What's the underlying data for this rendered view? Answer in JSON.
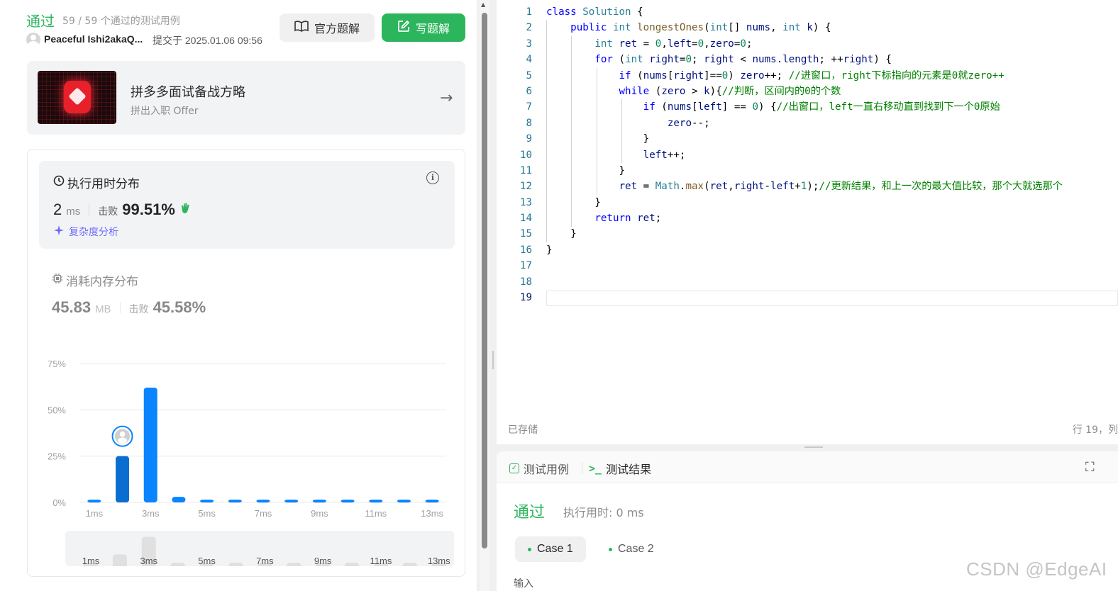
{
  "submission": {
    "status": "通过",
    "passed_cases": "59 / 59 个通过的测试用例",
    "username": "Peaceful Ishi2akaQ...",
    "submitted_at": "提交于 2025.01.06 09:56"
  },
  "buttons": {
    "official_solution": "官方题解",
    "write_solution": "写题解"
  },
  "promo": {
    "title": "拼多多面试备战方略",
    "subtitle": "拼出入职 Offer"
  },
  "runtime": {
    "title": "执行用时分布",
    "value": "2",
    "unit": "ms",
    "beat_label": "击败",
    "beat_pct": "99.51%",
    "complexity_link": "复杂度分析"
  },
  "memory": {
    "title": "消耗内存分布",
    "value": "45.83",
    "unit": "MB",
    "beat_label": "击败",
    "beat_pct": "45.58%"
  },
  "chart_data": {
    "type": "bar",
    "categories": [
      "1ms",
      "2ms",
      "3ms",
      "4ms",
      "5ms",
      "6ms",
      "7ms",
      "8ms",
      "9ms",
      "10ms",
      "11ms",
      "12ms",
      "13ms"
    ],
    "values": [
      1.5,
      25,
      62,
      3,
      1.5,
      1.5,
      1.5,
      1.5,
      1.5,
      1.5,
      1.5,
      1.5,
      1.5
    ],
    "tick_labels": [
      "1ms",
      "3ms",
      "5ms",
      "7ms",
      "9ms",
      "11ms",
      "13ms"
    ],
    "y_ticks": [
      "0%",
      "25%",
      "50%",
      "75%"
    ],
    "ylim": [
      0,
      75
    ],
    "highlight_category": "2ms",
    "colors": {
      "bar": "#0a84ff",
      "highlight": "#0a6ed1",
      "grid": "#e8e8e8"
    }
  },
  "minimap": {
    "tick_labels": [
      "1ms",
      "3ms",
      "5ms",
      "7ms",
      "9ms",
      "11ms",
      "13ms"
    ],
    "values": [
      1.5,
      25,
      62,
      3,
      1.5,
      1.5,
      1.5,
      1.5,
      1.5,
      1.5,
      1.5,
      1.5,
      1.5
    ]
  },
  "editor": {
    "line_numbers": [
      "1",
      "2",
      "3",
      "4",
      "5",
      "6",
      "7",
      "8",
      "9",
      "10",
      "11",
      "12",
      "13",
      "14",
      "15",
      "16",
      "17",
      "18",
      "19"
    ],
    "code": [
      "class Solution {",
      "    public int longestOnes(int[] nums, int k) {",
      "        int ret = 0,left=0,zero=0;",
      "        for (int right=0; right < nums.length; ++right) {",
      "            if (nums[right]==0) zero++; //进窗口，right下标指向的元素是0就zero++",
      "            while (zero > k){//判断，区间内的0的个数",
      "                if (nums[left] == 0) {//出窗口，left一直右移动直到找到下一个0原始",
      "                    zero--;",
      "                }",
      "                left++;",
      "            }",
      "            ret = Math.max(ret,right-left+1);//更新结果，和上一次的最大值比较，那个大就选那个",
      "        }",
      "        return ret;",
      "    }",
      "}",
      "",
      "",
      ""
    ],
    "saved_label": "已存储",
    "cursor_pos": "行 19，列"
  },
  "console": {
    "tab_cases": "测试用例",
    "tab_result": "测试结果",
    "status": "通过",
    "runtime": "执行用时: 0 ms",
    "case1": "Case 1",
    "case2": "Case 2",
    "input_label": "输入"
  },
  "watermark": "CSDN @EdgeAI"
}
